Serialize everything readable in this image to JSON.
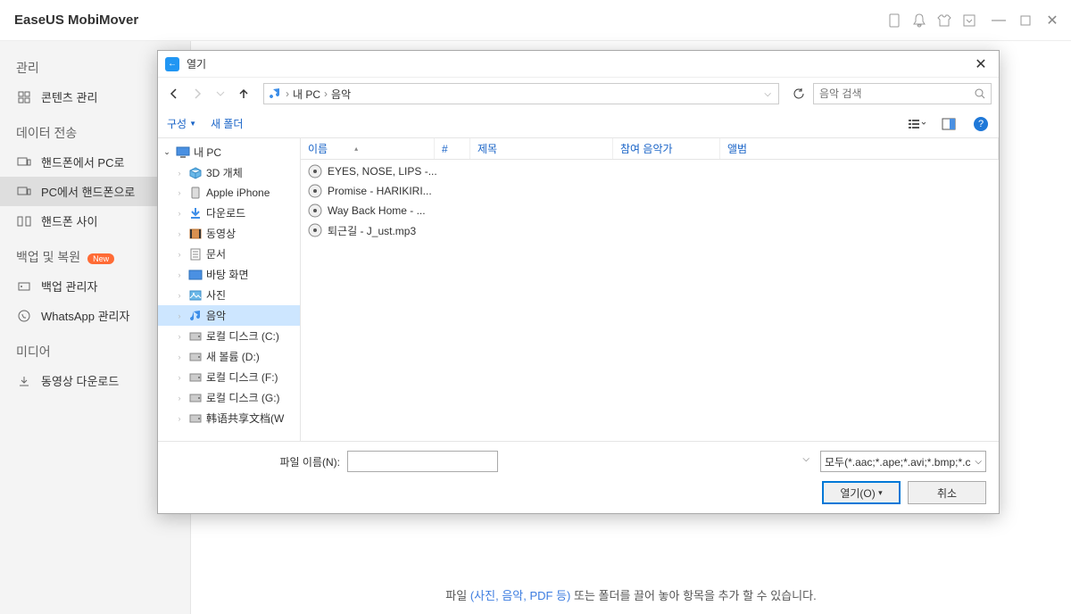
{
  "app": {
    "title": "EaseUS MobiMover"
  },
  "sidebar": {
    "sections": [
      {
        "label": "관리"
      },
      {
        "label": "데이터 전송"
      },
      {
        "label": "백업 및 복원"
      },
      {
        "label": "미디어"
      }
    ],
    "items": {
      "content_mgmt": "콘텐츠 관리",
      "phone_to_pc": "핸드폰에서 PC로",
      "pc_to_phone": "PC에서 핸드폰으로",
      "phone_to_phone": "핸드폰 사이",
      "backup_mgr": "백업 관리자",
      "whatsapp_mgr": "WhatsApp 관리자",
      "video_dl": "동영상 다운로드"
    },
    "badge_new": "New"
  },
  "hint": {
    "prefix": "파일 ",
    "accent": "(사진, 음악, PDF 등)",
    "suffix": " 또는 폴더를 끌어 놓아 항목을 추가 할 수 있습니다."
  },
  "dialog": {
    "title": "열기",
    "breadcrumb": {
      "root": "내 PC",
      "current": "음악"
    },
    "search_placeholder": "음악 검색",
    "toolbar": {
      "organize": "구성",
      "new_folder": "새 폴더"
    },
    "tree": [
      {
        "label": "내 PC",
        "icon": "monitor",
        "indent": 0,
        "expanded": true
      },
      {
        "label": "3D 개체",
        "icon": "cube",
        "indent": 1,
        "expanded": false
      },
      {
        "label": "Apple iPhone",
        "icon": "phone",
        "indent": 1,
        "expanded": false
      },
      {
        "label": "다운로드",
        "icon": "download",
        "indent": 1,
        "expanded": false
      },
      {
        "label": "동영상",
        "icon": "video",
        "indent": 1,
        "expanded": false
      },
      {
        "label": "문서",
        "icon": "doc",
        "indent": 1,
        "expanded": false
      },
      {
        "label": "바탕 화면",
        "icon": "desktop",
        "indent": 1,
        "expanded": false
      },
      {
        "label": "사진",
        "icon": "picture",
        "indent": 1,
        "expanded": false
      },
      {
        "label": "음악",
        "icon": "music",
        "indent": 1,
        "expanded": false,
        "selected": true
      },
      {
        "label": "로컬 디스크 (C:)",
        "icon": "drive",
        "indent": 1,
        "expanded": false
      },
      {
        "label": "새 볼륨 (D:)",
        "icon": "drive",
        "indent": 1,
        "expanded": false
      },
      {
        "label": "로컬 디스크 (F:)",
        "icon": "drive",
        "indent": 1,
        "expanded": false
      },
      {
        "label": "로컬 디스크 (G:)",
        "icon": "drive",
        "indent": 1,
        "expanded": false
      },
      {
        "label": "韩语共享文档(W",
        "icon": "drive",
        "indent": 1,
        "expanded": false
      }
    ],
    "columns": {
      "name": "이름",
      "num": "#",
      "title": "제목",
      "artist": "참여 음악가",
      "album": "앨범"
    },
    "files": [
      {
        "name": "EYES, NOSE, LIPS -..."
      },
      {
        "name": "Promise - HARIKIRI..."
      },
      {
        "name": "Way Back Home - ..."
      },
      {
        "name": "퇴근길 - J_ust.mp3"
      }
    ],
    "footer": {
      "filename_label": "파일 이름(N):",
      "filter": "모두(*.aac;*.ape;*.avi;*.bmp;*.c",
      "open_btn": "열기(O)",
      "cancel_btn": "취소"
    }
  }
}
